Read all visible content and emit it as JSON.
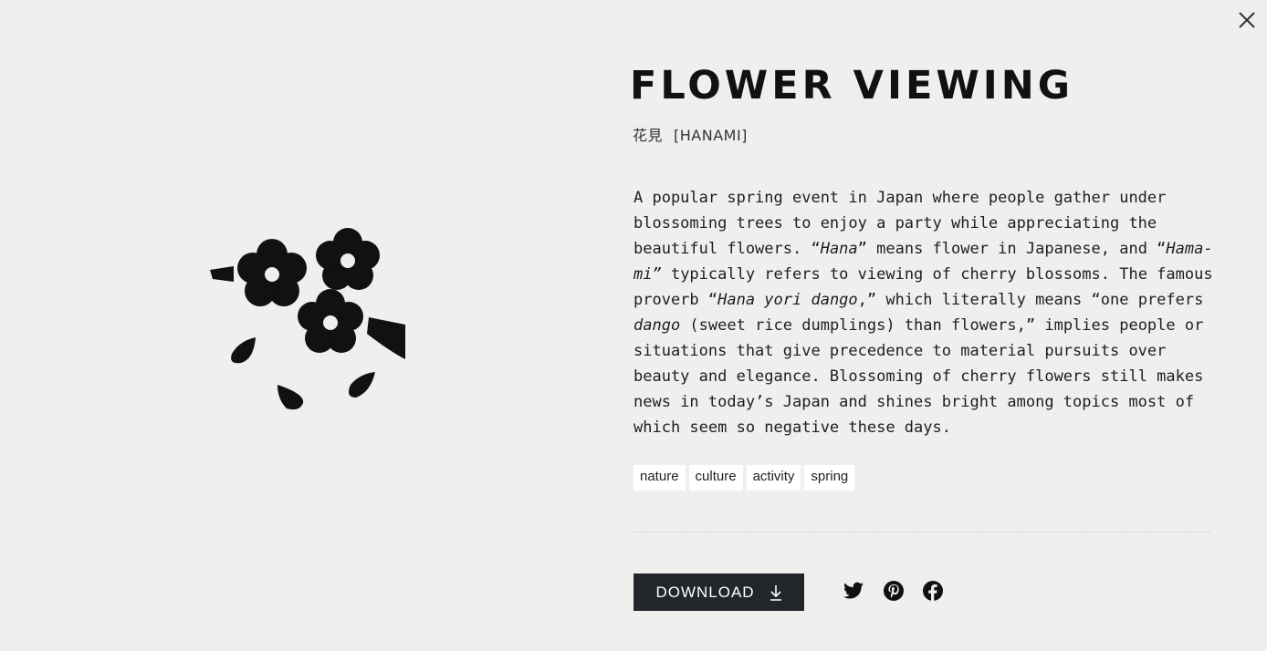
{
  "close": {
    "icon": "close-icon"
  },
  "illustration": {
    "icon": "cherry-blossom-illustration"
  },
  "title": "FLOWER VIEWING",
  "subtitle": {
    "kanji": "花見",
    "romaji": "[HANAMI]"
  },
  "description": [
    "A popular spring event in Japan where people gather under blossoming trees to enjoy a party while appreciating the beautiful flowers. “",
    "Hana",
    "” means flower in Japanese, and “",
    "Hama-mi”",
    " typically refers to viewing of cherry blossoms. The famous proverb “",
    "Hana yori dango",
    ",” which literally means “one prefers ",
    "dango",
    " (sweet rice dumplings) than flowers,” implies people or situations that give precedence to material pursuits over beauty and elegance. Blossoming of cherry flowers still makes news in today’s Japan and shines bright among topics most of which seem so negative these days."
  ],
  "tags": [
    "nature",
    "culture",
    "activity",
    "spring"
  ],
  "download": {
    "label": "DOWNLOAD",
    "icon": "download-icon"
  },
  "social": [
    "twitter-icon",
    "pinterest-icon",
    "facebook-icon"
  ],
  "colors": {
    "background": "#f0efee",
    "button": "#22262b",
    "ink": "#111111"
  }
}
